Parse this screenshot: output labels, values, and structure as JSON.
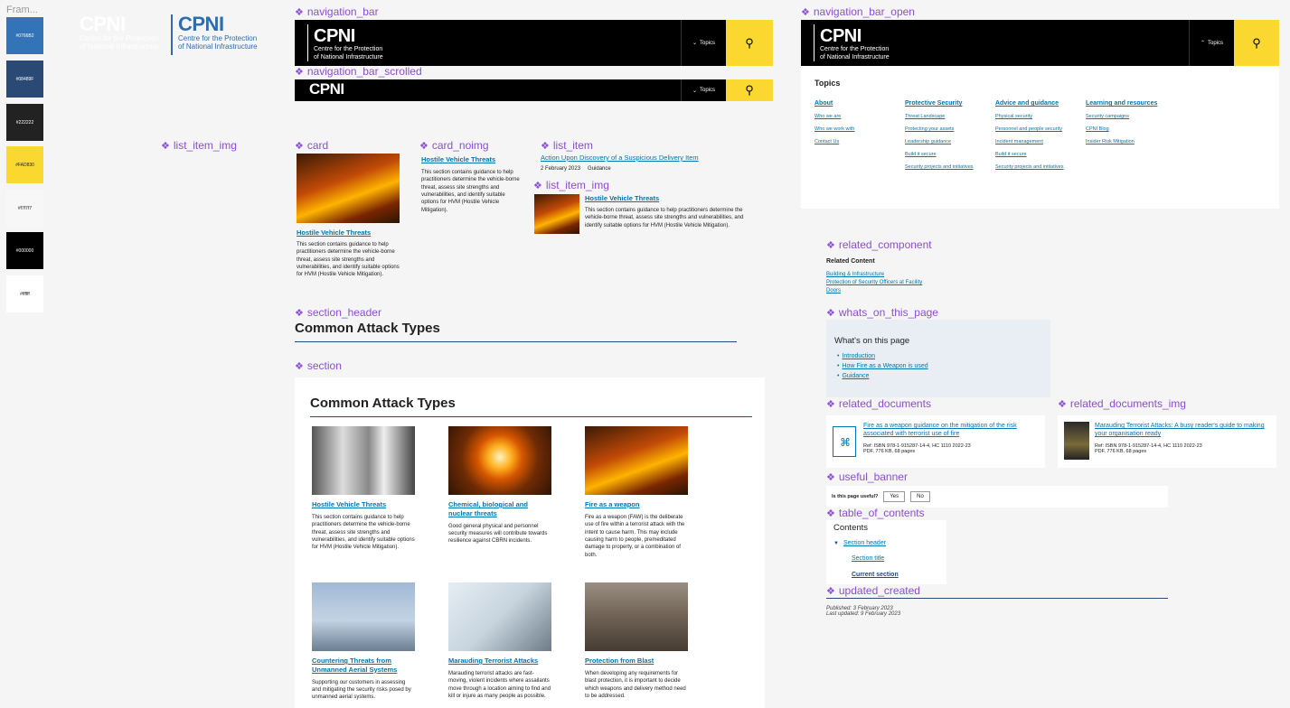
{
  "frame_label": "Fram...",
  "swatches": [
    {
      "label": "#0766B2",
      "color": "#3373b8",
      "text": "#ffffff"
    },
    {
      "label": "#08489F",
      "color": "#2a4a75",
      "text": "#ffffff"
    },
    {
      "label": "#222222",
      "color": "#222222",
      "text": "#ffffff"
    },
    {
      "label": "#FAD830",
      "color": "#fad830",
      "text": "#222222"
    },
    {
      "label": "#f7f7f7",
      "color": "#f7f7f7",
      "text": "#222222"
    },
    {
      "label": "#000000",
      "color": "#000000",
      "text": "#ffffff"
    },
    {
      "label": "#ffffff",
      "color": "#ffffff",
      "text": "#222222"
    }
  ],
  "logos": {
    "white": {
      "brand": "CPNI",
      "line1": "Centre for the Protection",
      "line2": "of National Infrastructure"
    },
    "blue": {
      "brand": "CPNI",
      "line1": "Centre for the Protection",
      "line2": "of National Infrastructure"
    }
  },
  "labels": {
    "navigation_bar": "navigation_bar",
    "navigation_bar_scrolled": "navigation_bar_scrolled",
    "navigation_bar_open": "navigation_bar_open",
    "list_item_img_left": "list_item_img",
    "card": "card",
    "card_noimg": "card_noimg",
    "list_item": "list_item",
    "list_item_img": "list_item_img",
    "section_header": "section_header",
    "section": "section",
    "related_component": "related_component",
    "whats_on_this_page": "whats_on_this_page",
    "related_documents": "related_documents",
    "related_documents_img": "related_documents_img",
    "useful_banner": "useful_banner",
    "table_of_contents": "table_of_contents",
    "updated_created": "updated_created"
  },
  "nav": {
    "brand": "CPNI",
    "line1": "Centre for the Protection",
    "line2": "of National Infrastructure",
    "topics": "Topics"
  },
  "menu": {
    "title": "Topics",
    "columns": [
      {
        "heading": "About",
        "items": [
          "Who we are",
          "Who we work with",
          "Contact Us"
        ]
      },
      {
        "heading": "Protective Security",
        "items": [
          "Threat Landscape",
          "Protecting your assets",
          "Leadership guidance",
          "Build it secure",
          "Security projects and initiatives"
        ]
      },
      {
        "heading": "Advice and guidance",
        "items": [
          "Physical security",
          "Personnel and people security",
          "Incident management",
          "Build it secure",
          "Security projects and initiatives"
        ]
      },
      {
        "heading": "Learning and resources",
        "items": [
          "Security campaigns",
          "CPNI Blog",
          "Insider Risk Mitigation"
        ]
      }
    ]
  },
  "card": {
    "title": "Hostile Vehicle Threats",
    "text": "This section contains guidance to help practitioners determine the vehicle-borne threat, assess site strengths and vulnerabilities, and identify suitable options for HVM (Hostile Vehicle Mitigation)."
  },
  "list_item": {
    "title": "Action Upon Discovery of a Suspicious Delivery Item",
    "date": "2 February 2023",
    "type": "Guidance"
  },
  "section_header": {
    "title": "Common Attack Types"
  },
  "section": {
    "title": "Common Attack Types",
    "cards": [
      {
        "title": "Hostile Vehicle Threats",
        "text": "This section contains guidance to help practitioners determine the vehicle-borne threat, assess site strengths and vulnerabilities, and identify suitable options for HVM (Hostile Vehicle Mitigation)."
      },
      {
        "title": "Chemical, biological and nuclear threats",
        "text": "Good general physical and personnel security measures will contribute towards resilience against CBRN incidents."
      },
      {
        "title": "Fire as a weapon",
        "text": "Fire as a weapon (FAW) is the deliberate use of fire within a terrorist attack with the intent to cause harm. This may include causing harm to people, premeditated damage to property, or a combination of both."
      },
      {
        "title": "Countering Threats from Unmanned Aerial Systems",
        "text": "Supporting our customers in assessing and mitigating the security risks posed by unmanned aerial systems."
      },
      {
        "title": "Marauding Terrorist Attacks",
        "text": "Marauding terrorist attacks are fast-moving, violent incidents where assailants move through a location aiming to find and kill or injure as many people as possible."
      },
      {
        "title": "Protection from Blast",
        "text": "When developing any requirements for blast protection, it is important to decide which weapons and delivery method need to be addressed."
      }
    ]
  },
  "related": {
    "heading": "Related Content",
    "links": [
      "Building & Infrastructure",
      "Protection of Security Officers at Facility",
      "Doors"
    ]
  },
  "whats_on": {
    "heading": "What's on this page",
    "links": [
      "Introduction",
      "How Fire as a Weapon is used",
      "Guidance"
    ]
  },
  "related_doc": {
    "title": "Fire as a weapon guidance on the mitigation of the risk associated with terrorist use of fire",
    "ref": "Ref: ISBN 978-1-915287-14-4, HC 1110 2022-23",
    "meta": "PDF, 776 KB, 68 pages"
  },
  "related_doc_img": {
    "title": "Marauding Terrorist Attacks: A busy reader's guide to making your organisation ready",
    "ref": "Ref: ISBN 978-1-915287-14-4, HC 1110 2022-23",
    "meta": "PDF, 776 KB, 68 pages"
  },
  "useful": {
    "question": "Is this page useful?",
    "yes": "Yes",
    "no": "No"
  },
  "toc": {
    "heading": "Contents",
    "section_header": "Section header",
    "section_title": "Section title",
    "current": "Current section"
  },
  "updated": {
    "published": "Published: 3 February 2023",
    "updated": "Last updated: 9 February 2023"
  }
}
